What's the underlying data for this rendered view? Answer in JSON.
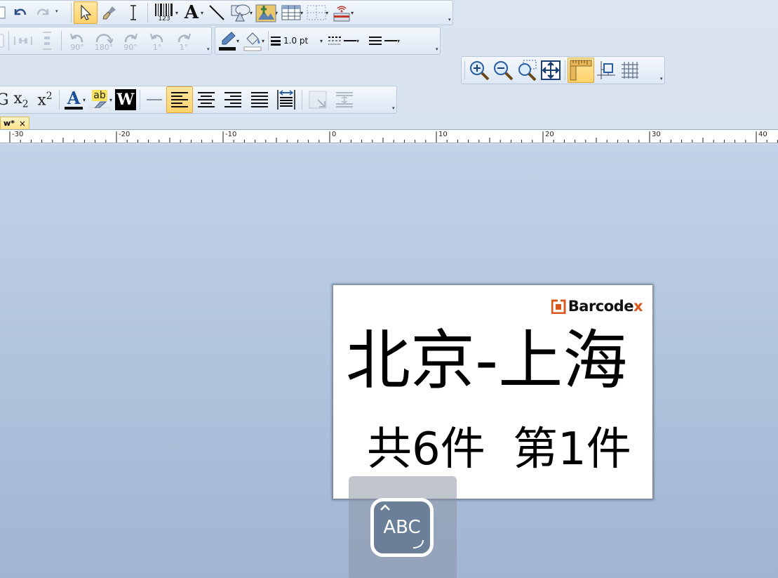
{
  "toolbar_main": {
    "barcode_caption": "123"
  },
  "toolbar_transform": {
    "rot_left_90": "90°",
    "rot_180": "180°",
    "rot_right_90": "90°",
    "rot_left_1": "1°",
    "rot_right_1": "1°"
  },
  "toolbar_line": {
    "line_width": "1.0 pt"
  },
  "toolbar_text": {
    "bold_fragment": "G",
    "subscript": "x",
    "subscript_mark": "2",
    "superscript": "x",
    "superscript_mark": "2",
    "font_color": "A",
    "highlight": "ab",
    "wordart": "W"
  },
  "tab": {
    "label": "w*",
    "close": "×"
  },
  "ruler": {
    "labels": [
      "-30",
      "-20",
      "-10",
      "0",
      "10",
      "20",
      "30",
      "40"
    ]
  },
  "label": {
    "logo_text": "Barcodex",
    "title": "北京-上海",
    "total": "共6件",
    "current": "第1件"
  },
  "keyboard": {
    "caption": "ABC"
  },
  "colors": {
    "active_button": "#ffd26b",
    "logo_orange": "#d9581e",
    "accent_blue": "#1a4f9c"
  }
}
